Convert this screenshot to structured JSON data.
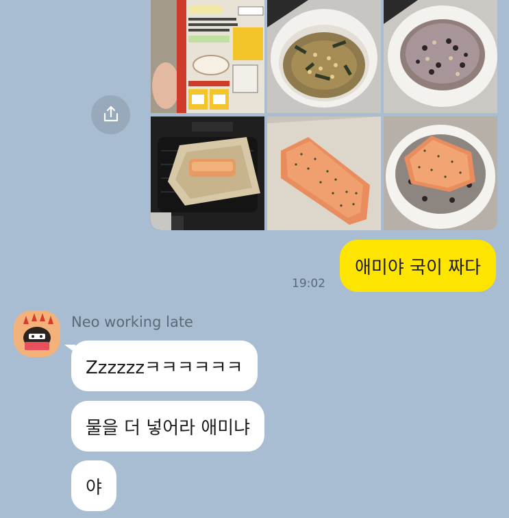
{
  "colors": {
    "background": "#a8bdd1",
    "outgoing_bubble": "#fee500",
    "incoming_bubble": "#ffffff"
  },
  "share_button": {
    "icon": "share-icon"
  },
  "photos": [
    {
      "name": "photo-package-instructions"
    },
    {
      "name": "photo-soup-bowl"
    },
    {
      "name": "photo-rice-bowl"
    },
    {
      "name": "photo-air-fryer-salmon"
    },
    {
      "name": "photo-cooked-salmon"
    },
    {
      "name": "photo-salmon-rice-bowl"
    }
  ],
  "outgoing": {
    "text": "애미야 국이 짜다",
    "time": "19:02"
  },
  "incoming": {
    "sender": "Neo working late",
    "messages": [
      "Zzzzzzㅋㅋㅋㅋㅋㅋ",
      "물을 더 넣어라 애미냐",
      "야"
    ]
  }
}
